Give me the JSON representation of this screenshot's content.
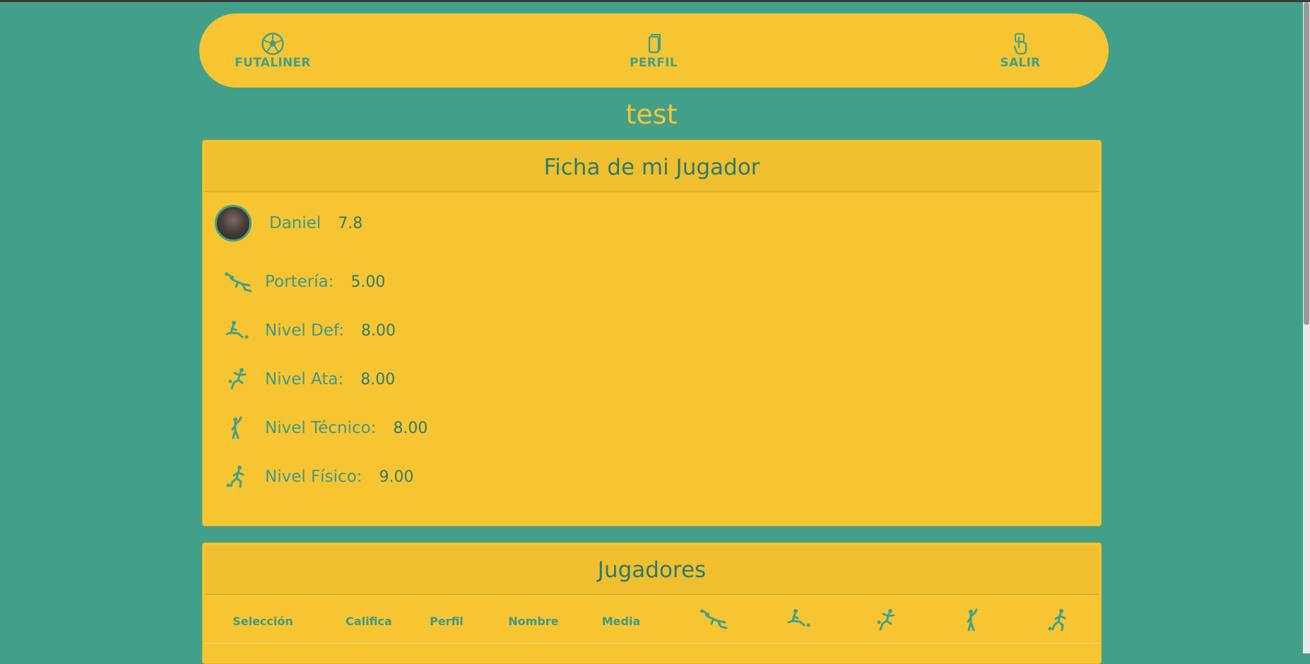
{
  "navbar": {
    "items": [
      {
        "label": "FUTALINER",
        "icon": "soccer-ball-icon"
      },
      {
        "label": "PERFIL",
        "icon": "phone-card-icon"
      },
      {
        "label": "SALIR",
        "icon": "hand-pointer-icon"
      }
    ]
  },
  "page": {
    "title": "test"
  },
  "player_card": {
    "header": "Ficha de mi Jugador",
    "player": {
      "name": "Daniel",
      "average": "7.8"
    },
    "stats": [
      {
        "label": "Portería:",
        "value": "5.00",
        "icon": "goalkeeper-dive-icon"
      },
      {
        "label": "Nivel Def:",
        "value": "8.00",
        "icon": "defender-tackle-icon"
      },
      {
        "label": "Nivel Ata:",
        "value": "8.00",
        "icon": "attacker-kick-icon"
      },
      {
        "label": "Nivel Técnico:",
        "value": "8.00",
        "icon": "technique-player-icon"
      },
      {
        "label": "Nivel Físico:",
        "value": "9.00",
        "icon": "runner-ball-icon"
      }
    ]
  },
  "players_card": {
    "header": "Jugadores",
    "columns": [
      "Selección",
      "Califica",
      "Perfil",
      "Nombre",
      "Media"
    ],
    "icon_columns": [
      "goalkeeper-dive-icon",
      "defender-tackle-icon",
      "attacker-kick-icon",
      "technique-player-icon",
      "runner-ball-icon"
    ]
  },
  "colors": {
    "background": "#42a08a",
    "accent": "#f7c531",
    "text_primary": "#2e7a6c",
    "text_label": "#3e9a87"
  }
}
